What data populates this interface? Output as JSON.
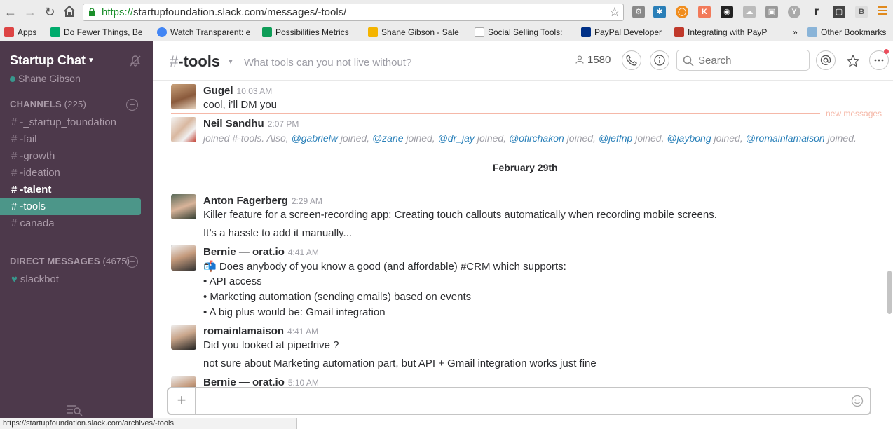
{
  "browser": {
    "url_scheme": "https://",
    "url_rest": "startupfoundation.slack.com/messages/-tools/",
    "bookmarks": [
      {
        "label": "Apps",
        "icon": "apps-grid-icon",
        "color": "#d44"
      },
      {
        "label": "Do Fewer Things, Be",
        "icon": "medium-icon",
        "color": "#00ab6c"
      },
      {
        "label": "Watch Transparent: e",
        "icon": "google-icon",
        "color": "#4285f4"
      },
      {
        "label": "Possibilities Metrics",
        "icon": "sheets-icon",
        "color": "#0f9d58"
      },
      {
        "label": "Shane Gibson - Sale",
        "icon": "drive-icon",
        "color": "#f4b400"
      },
      {
        "label": "Social Selling Tools:",
        "icon": "page-icon",
        "color": "#aaaaaa"
      },
      {
        "label": "PayPal Developer",
        "icon": "paypal-icon",
        "color": "#003087"
      },
      {
        "label": "Integrating with PayP",
        "icon": "integration-icon",
        "color": "#c0392b"
      }
    ],
    "more_label": "»",
    "other_bookmarks": "Other Bookmarks",
    "status_url": "https://startupfoundation.slack.com/archives/-tools"
  },
  "sidebar": {
    "team_name": "Startup Chat",
    "user_name": "Shane Gibson",
    "channels_label": "CHANNELS",
    "channels_count": "(225)",
    "channels": [
      {
        "name": "-_startup_foundation",
        "style": "normal"
      },
      {
        "name": "-fail",
        "style": "normal"
      },
      {
        "name": "-growth",
        "style": "normal"
      },
      {
        "name": "-ideation",
        "style": "normal"
      },
      {
        "name": "-talent",
        "style": "bold"
      },
      {
        "name": "-tools",
        "style": "active"
      },
      {
        "name": "canada",
        "style": "normal"
      }
    ],
    "dm_label": "DIRECT MESSAGES",
    "dm_count": "(4675)",
    "dms": [
      {
        "name": "slackbot"
      }
    ]
  },
  "header": {
    "channel": "-tools",
    "hash": "#",
    "topic": "What tools can you not live without?",
    "member_count": "1580",
    "search_placeholder": "Search"
  },
  "messages": {
    "gugel": {
      "author": "Gugel",
      "time": "10:03 AM",
      "text": "cool, i’ll DM you"
    },
    "new_messages_label": "new messages",
    "neil": {
      "author": "Neil Sandhu",
      "time": "2:07 PM",
      "joined_prefix": "joined #-tools. Also,",
      "mentions": [
        "@gabrielw",
        "@zane",
        "@dr_jay",
        "@ofirchakon",
        "@jeffnp",
        "@jaybong",
        "@romainlamaison"
      ],
      "joined_word": "joined,",
      "joined_last": "joined."
    },
    "day_divider": "February 29th",
    "anton": {
      "author": "Anton Fagerberg",
      "time": "2:29 AM",
      "lines": [
        "Killer feature for a screen-recording app: Creating touch callouts automatically when recording mobile screens.",
        "It’s a hassle to add it manually..."
      ]
    },
    "bernie1": {
      "author": "Bernie — orat.io",
      "time": "4:41 AM",
      "lines": [
        "📬 Does anybody of you know a good (and affordable) #CRM which supports:",
        "• API access",
        "• Marketing automation (sending emails) based on events",
        "• A big plus would be: Gmail integration"
      ]
    },
    "romain": {
      "author": "romainlamaison",
      "time": "4:41 AM",
      "lines": [
        "Did you looked at pipedrive ?",
        "not sure about Marketing automation part, but API + Gmail integration works just fine"
      ]
    },
    "bernie2": {
      "author": "Bernie — orat.io",
      "time": "5:10 AM"
    }
  },
  "composer": {
    "placeholder": ""
  },
  "colors": {
    "sidebar_bg": "#4d394b",
    "active_channel": "#4c9689",
    "mention": "#2a80b9",
    "new_messages": "#f5b8a8"
  }
}
